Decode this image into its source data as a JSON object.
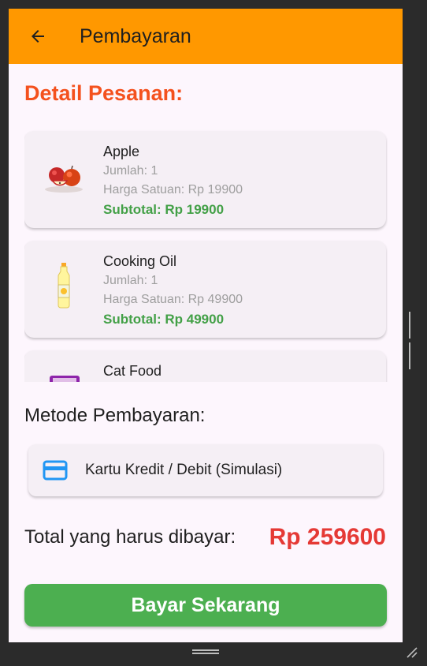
{
  "app_bar": {
    "title": "Pembayaran",
    "back_icon": "arrow-left-icon",
    "color": "#ff9800"
  },
  "order_section": {
    "title": "Detail Pesanan:",
    "items": [
      {
        "name": "Apple",
        "qty": "Jumlah: 1",
        "unit_price": "Harga Satuan: Rp 19900",
        "subtotal": "Subtotal: Rp 19900",
        "image": "apple-image"
      },
      {
        "name": "Cooking Oil",
        "qty": "Jumlah: 1",
        "unit_price": "Harga Satuan: Rp 49900",
        "subtotal": "Subtotal: Rp 49900",
        "image": "cooking-oil-image"
      },
      {
        "name": "Cat Food",
        "image": "cat-food-image"
      }
    ]
  },
  "payment_method": {
    "title": "Metode Pembayaran:",
    "selected_label": "Kartu Kredit / Debit (Simulasi)",
    "icon": "credit-card-icon",
    "icon_color": "#2196f3"
  },
  "total": {
    "label": "Total yang harus dibayar:",
    "value": "Rp 259600",
    "color": "#e53935"
  },
  "pay_button": {
    "label": "Bayar Sekarang",
    "color": "#4caf50"
  },
  "colors": {
    "section_title": "#f4511e",
    "subtotal": "#43a047",
    "background": "#fdf6fd"
  }
}
